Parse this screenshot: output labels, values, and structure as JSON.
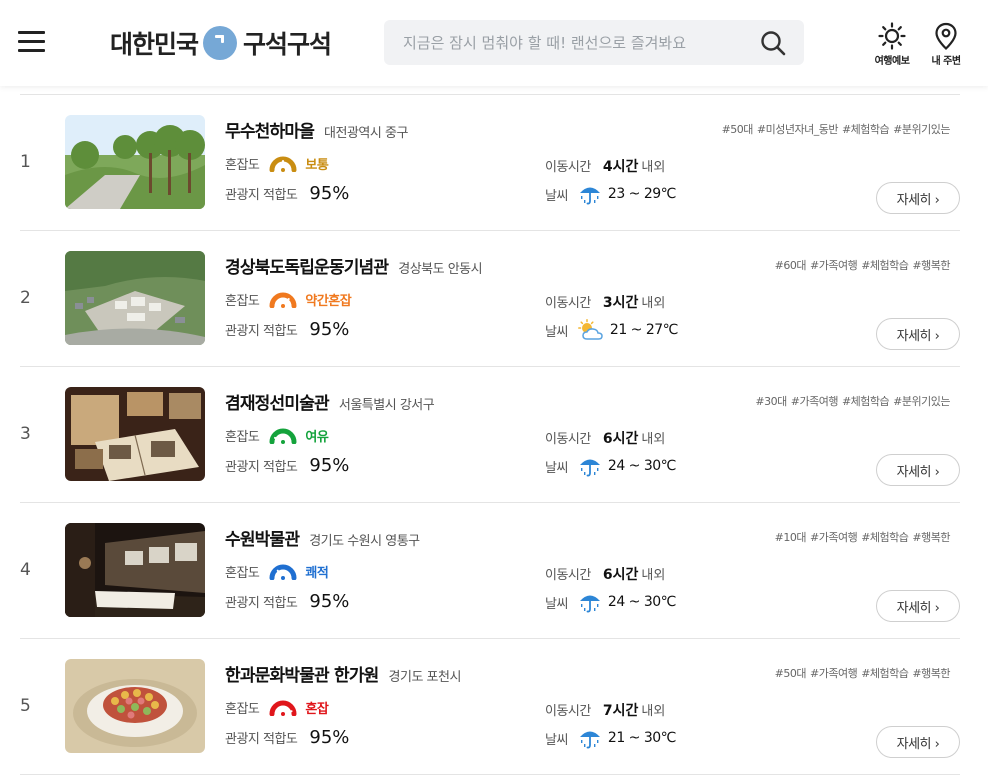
{
  "header": {
    "logo_left": "대한민국",
    "logo_right": "구석구석",
    "search_placeholder": "지금은 잠시 멈춰야 할 때! 랜선으로 즐겨봐요",
    "forecast_label": "여행예보",
    "nearby_label": "내 주변"
  },
  "labels": {
    "crowd": "혼잡도",
    "fit": "관광지 적합도",
    "travel": "이동시간",
    "travel_unit": "내외",
    "weather": "날씨",
    "detail": "자세히 ›"
  },
  "colors": {
    "normal": "#c98d12",
    "slightly_crowded": "#f0791f",
    "relaxed": "#14a33c",
    "comfortable": "#1f6fd1",
    "crowded": "#e0161b",
    "logo_circle": "#76a8d6"
  },
  "items": [
    {
      "rank": "1",
      "name": "무수천하마을",
      "region": "대전광역시 중구",
      "tags": [
        "#50대",
        "#미성년자녀_동반",
        "#체험학습",
        "#분위기있는"
      ],
      "crowd": "보통",
      "crowd_level": 0.5,
      "crowd_color": "#c98d12",
      "fit": "95%",
      "travel": "4시간",
      "weather_icon": "umbrella-icon",
      "temp": "23 ~ 29℃"
    },
    {
      "rank": "2",
      "name": "경상북도독립운동기념관",
      "region": "경상북도 안동시",
      "tags": [
        "#60대",
        "#가족여행",
        "#체험학습",
        "#행복한"
      ],
      "crowd": "약간혼잡",
      "crowd_level": 0.72,
      "crowd_color": "#f0791f",
      "fit": "95%",
      "travel": "3시간",
      "weather_icon": "partly-cloudy-icon",
      "temp": "21 ~ 27℃"
    },
    {
      "rank": "3",
      "name": "겸재정선미술관",
      "region": "서울특별시 강서구",
      "tags": [
        "#30대",
        "#가족여행",
        "#체험학습",
        "#분위기있는"
      ],
      "crowd": "여유",
      "crowd_level": 0.15,
      "crowd_color": "#14a33c",
      "fit": "95%",
      "travel": "6시간",
      "weather_icon": "umbrella-icon",
      "temp": "24 ~ 30℃"
    },
    {
      "rank": "4",
      "name": "수원박물관",
      "region": "경기도 수원시 영통구",
      "tags": [
        "#10대",
        "#가족여행",
        "#체험학습",
        "#행복한"
      ],
      "crowd": "쾌적",
      "crowd_level": 0.3,
      "crowd_color": "#1f6fd1",
      "fit": "95%",
      "travel": "6시간",
      "weather_icon": "umbrella-icon",
      "temp": "24 ~ 30℃"
    },
    {
      "rank": "5",
      "name": "한과문화박물관 한가원",
      "region": "경기도 포천시",
      "tags": [
        "#50대",
        "#가족여행",
        "#체험학습",
        "#행복한"
      ],
      "crowd": "혼잡",
      "crowd_level": 0.9,
      "crowd_color": "#e0161b",
      "fit": "95%",
      "travel": "7시간",
      "weather_icon": "umbrella-icon",
      "temp": "21 ~ 30℃"
    }
  ]
}
